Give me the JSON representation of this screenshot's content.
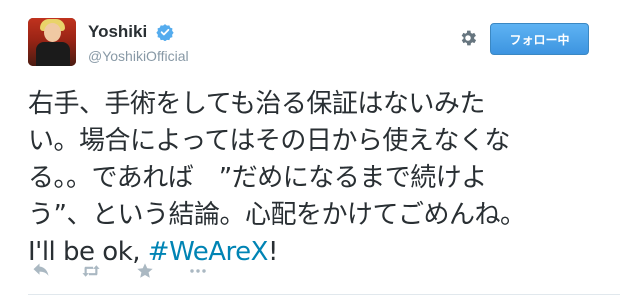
{
  "user": {
    "name": "Yoshiki",
    "handle": "@YoshikiOfficial",
    "verified": true
  },
  "follow_button": {
    "label": "フォロー中"
  },
  "tweet": {
    "text": "右手、手術をしても治る保証はないみた\nい。場合によってはその日から使えなくな\nる。。であれば　”だめになるまで続けよ\nう”、という結論。心配をかけてごめんね。\nI'll be ok, ",
    "hashtag": "#WeAreX",
    "text_end": "!"
  },
  "actions": [
    {
      "icon": "reply-icon"
    },
    {
      "icon": "retweet-icon"
    },
    {
      "icon": "star-icon"
    },
    {
      "icon": "more-icon"
    }
  ],
  "colors": {
    "link": "#0084b4",
    "button": "#4aa2e8",
    "secondary_text": "#8899a6",
    "verified": "#55acee"
  }
}
